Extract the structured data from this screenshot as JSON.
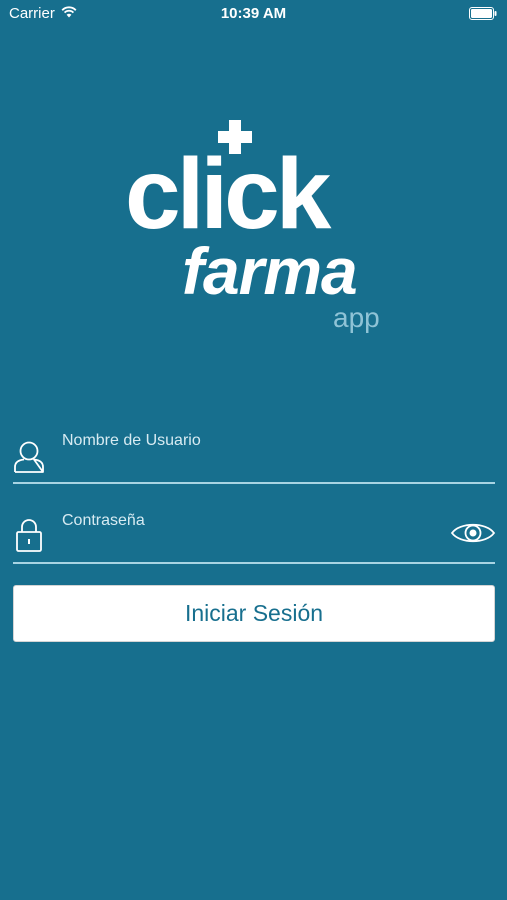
{
  "status_bar": {
    "carrier": "Carrier",
    "time": "10:39 AM",
    "icons": [
      "wifi-icon",
      "battery-icon"
    ]
  },
  "logo": {
    "click": "click",
    "farma": "farma",
    "app": "app"
  },
  "form": {
    "username_placeholder": "Nombre de Usuario",
    "password_placeholder": "Contraseña",
    "login_label": "Iniciar Sesión"
  },
  "colors": {
    "background": "#176F8E",
    "accent_light": "#8FC3D6",
    "button_bg": "#FFFFFF",
    "button_text": "#176F8E"
  }
}
